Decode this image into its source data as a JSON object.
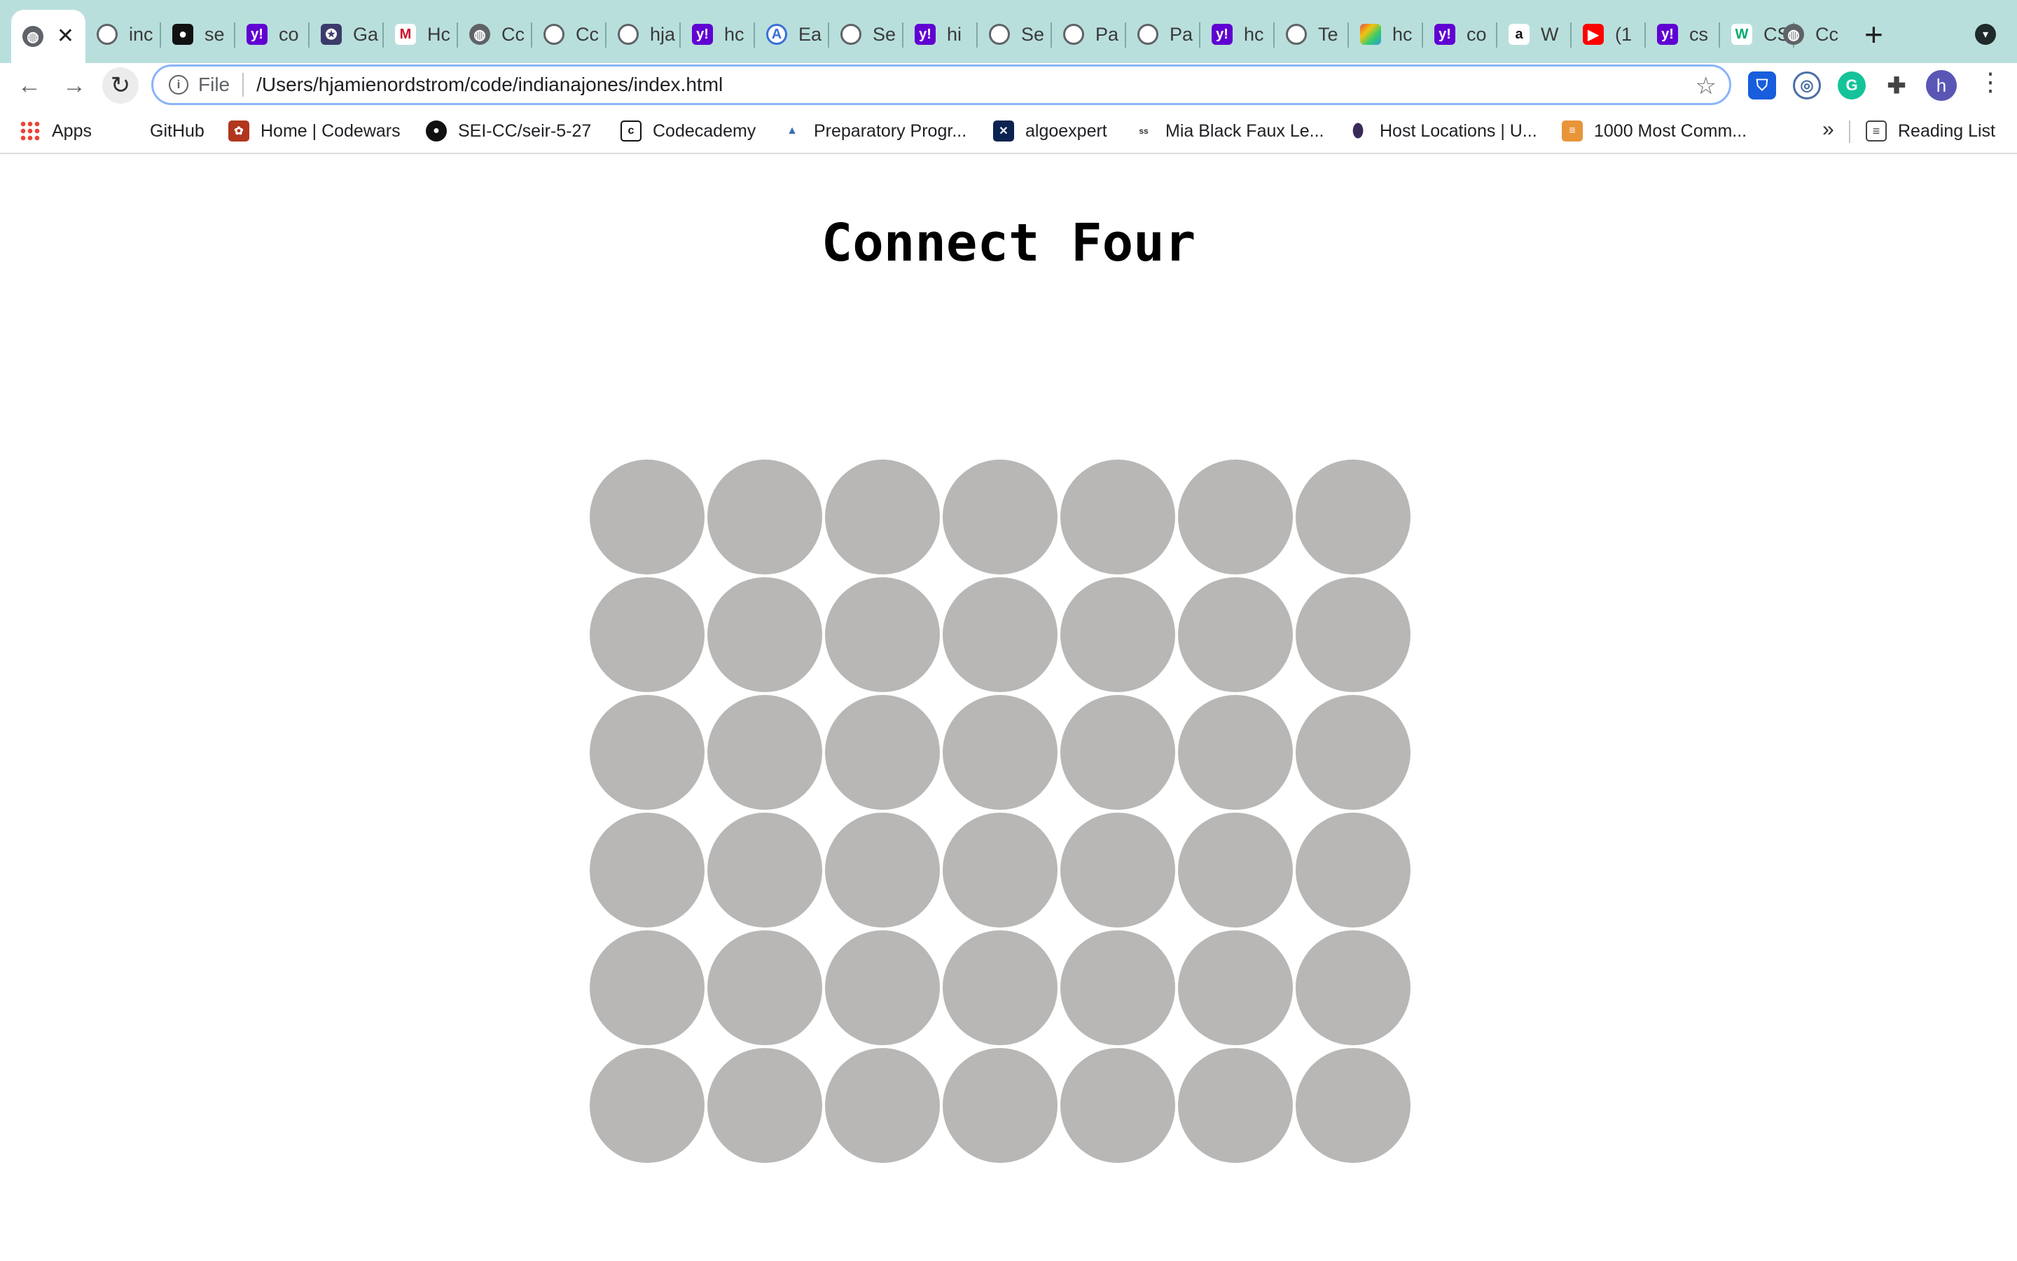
{
  "browser": {
    "tabs": [
      {
        "title": "",
        "icon": "globe-icon",
        "active": true
      },
      {
        "title": "inc",
        "icon": "github-icon"
      },
      {
        "title": "se",
        "icon": "github-dark-icon"
      },
      {
        "title": "co",
        "icon": "yahoo-icon"
      },
      {
        "title": "Ga",
        "icon": "game-icon"
      },
      {
        "title": "Hc",
        "icon": "m-icon"
      },
      {
        "title": "Cc",
        "icon": "globe-icon"
      },
      {
        "title": "Cc",
        "icon": "github-icon"
      },
      {
        "title": "hja",
        "icon": "github-icon"
      },
      {
        "title": "hc",
        "icon": "yahoo-icon"
      },
      {
        "title": "Ea",
        "icon": "a-circle-icon"
      },
      {
        "title": "Se",
        "icon": "github-icon"
      },
      {
        "title": "hi",
        "icon": "yahoo-icon"
      },
      {
        "title": "Se",
        "icon": "github-icon"
      },
      {
        "title": "Pa",
        "icon": "github-icon"
      },
      {
        "title": "Pa",
        "icon": "github-icon"
      },
      {
        "title": "hc",
        "icon": "yahoo-icon"
      },
      {
        "title": "Te",
        "icon": "github-icon"
      },
      {
        "title": "hc",
        "icon": "colorful-icon"
      },
      {
        "title": "co",
        "icon": "yahoo-icon"
      },
      {
        "title": "W",
        "icon": "amazon-icon"
      },
      {
        "title": "(1",
        "icon": "youtube-icon"
      },
      {
        "title": "cs",
        "icon": "yahoo-icon"
      },
      {
        "title": "CS",
        "icon": "w3-icon"
      },
      {
        "title": "Cc",
        "icon": "globe-icon"
      }
    ],
    "address_bar": {
      "scheme_label": "File",
      "url": "/Users/hjamienordstrom/code/indianajones/index.html"
    },
    "profile_initial": "h",
    "bookmarks": [
      {
        "label": "Apps",
        "icon": "apps-grid-icon"
      },
      {
        "label": "GitHub",
        "icon": "blank-icon"
      },
      {
        "label": "Home | Codewars",
        "icon": "codewars-icon"
      },
      {
        "label": "SEI-CC/seir-5-27",
        "icon": "github-dark-icon"
      },
      {
        "label": "Codecademy",
        "icon": "codecademy-icon"
      },
      {
        "label": "Preparatory Progr...",
        "icon": "preparatory-icon"
      },
      {
        "label": "algoexpert",
        "icon": "algoexpert-icon"
      },
      {
        "label": "Mia Black Faux Le...",
        "icon": "shop-icon"
      },
      {
        "label": "Host Locations | U...",
        "icon": "location-pin-icon"
      },
      {
        "label": "1000 Most Comm...",
        "icon": "list-doc-icon"
      }
    ],
    "bookmarks_overflow": "»",
    "reading_list_label": "Reading List"
  },
  "page": {
    "title": "Connect Four",
    "board": {
      "rows": 6,
      "columns": 7,
      "empty_color": "#b8b7b5"
    }
  }
}
